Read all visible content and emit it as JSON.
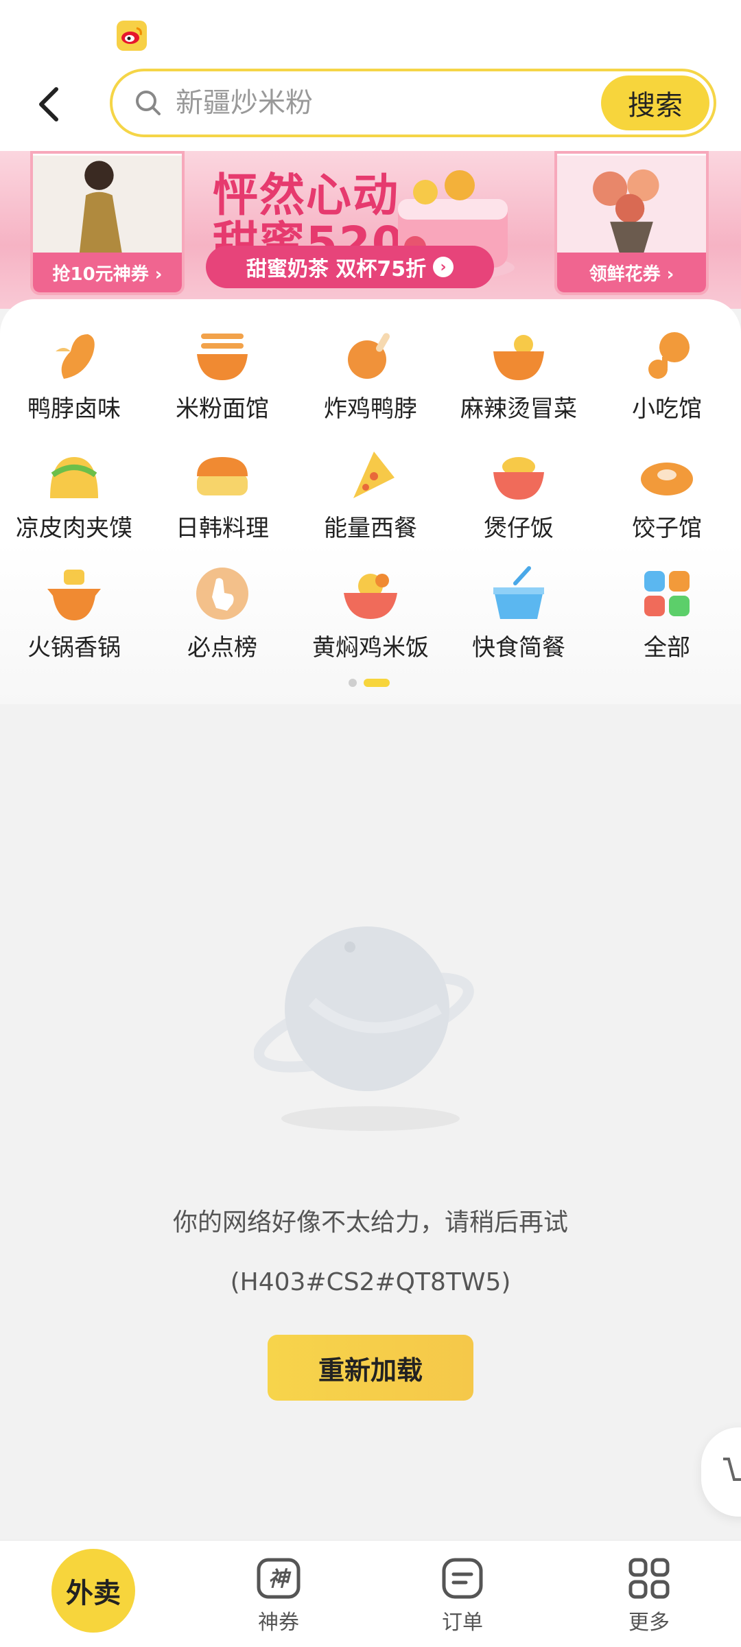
{
  "header": {
    "search_placeholder": "新疆炒米粉",
    "search_button": "搜索"
  },
  "banner": {
    "title_line1": "怦然心动",
    "title_line2": "甜蜜520",
    "left_caption": "抢10元神券 ›",
    "pill_text": "甜蜜奶茶 双杯75折",
    "right_caption": "领鲜花券 ›"
  },
  "categories": [
    {
      "label": "鸭脖卤味",
      "icon": "duck-neck-icon"
    },
    {
      "label": "米粉面馆",
      "icon": "noodle-bowl-icon"
    },
    {
      "label": "炸鸡鸭脖",
      "icon": "fried-chicken-icon"
    },
    {
      "label": "麻辣烫冒菜",
      "icon": "spicy-pot-icon"
    },
    {
      "label": "小吃馆",
      "icon": "snack-icon"
    },
    {
      "label": "凉皮肉夹馍",
      "icon": "taco-icon"
    },
    {
      "label": "日韩料理",
      "icon": "sushi-icon"
    },
    {
      "label": "能量西餐",
      "icon": "pizza-icon"
    },
    {
      "label": "煲仔饭",
      "icon": "claypot-rice-icon"
    },
    {
      "label": "饺子馆",
      "icon": "dumpling-icon"
    },
    {
      "label": "火锅香锅",
      "icon": "hotpot-icon"
    },
    {
      "label": "必点榜",
      "icon": "pointer-icon"
    },
    {
      "label": "黄焖鸡米饭",
      "icon": "chicken-rice-icon"
    },
    {
      "label": "快食简餐",
      "icon": "fast-food-icon"
    },
    {
      "label": "全部",
      "icon": "all-grid-icon"
    }
  ],
  "empty_state": {
    "message": "你的网络好像不太给力，请稍后再试",
    "code": "(H403#CS2#QT8TW5)",
    "reload_button": "重新加载"
  },
  "bottom_nav": {
    "waimai": "外卖",
    "coupons": "神券",
    "coupons_icon_glyph": "神",
    "orders": "订单",
    "more": "更多"
  },
  "colors": {
    "accent_yellow": "#f7d53c",
    "banner_pink": "#e7447a"
  }
}
